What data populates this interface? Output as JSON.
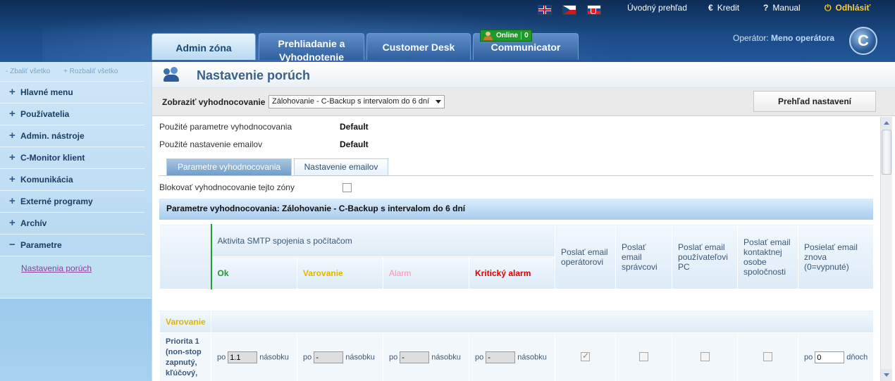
{
  "header": {
    "links": {
      "overview": "Úvodný prehľad",
      "credit": "Kredit",
      "manual": "Manual",
      "logout": "Odhlásiť"
    },
    "icons": {
      "credit": "euro-icon",
      "manual": "question-icon",
      "logout": "power-icon"
    },
    "tabs": {
      "admin": "Admin zóna",
      "review_line1": "Prehliadanie a",
      "review_line2": "Vyhodnotenie",
      "desk": "Customer Desk",
      "communicator": "Communicator"
    },
    "online": {
      "label": "Online",
      "count": "0"
    },
    "operator": {
      "label": "Operátor:",
      "name": "Meno operátora"
    },
    "logo_letter": "C"
  },
  "sidebar": {
    "collapse_all": "- Zbaliť všetko",
    "expand_all": "+ Rozbaliť všetko",
    "items": [
      {
        "sign": "+",
        "label": "Hlavné menu"
      },
      {
        "sign": "+",
        "label": "Používatelia"
      },
      {
        "sign": "+",
        "label": "Admin. nástroje"
      },
      {
        "sign": "+",
        "label": "C-Monitor klient"
      },
      {
        "sign": "+",
        "label": "Komunikácia"
      },
      {
        "sign": "+",
        "label": "Externé programy"
      },
      {
        "sign": "+",
        "label": "Archív"
      },
      {
        "sign": "−",
        "label": "Parametre"
      }
    ],
    "subitem": "Nastavenia porúch"
  },
  "main": {
    "title": "Nastavenie porúch",
    "filter_label": "Zobraziť vyhodnocovanie",
    "filter_value": "Zálohovanie - C-Backup s intervalom do 6 dní",
    "overview_button": "Prehľad nastavení",
    "info": {
      "params_label": "Použité parametre vyhodnocovania",
      "params_value": "Default",
      "email_label": "Použité nastavenie emailov",
      "email_value": "Default"
    },
    "subtabs": {
      "params": "Parametre vyhodnocovania",
      "email": "Nastavenie emailov"
    },
    "block_label": "Blokovať vyhodnocovanie tejto zóny",
    "section_title": "Parametre vyhodnocovania: Zálohovanie - C-Backup s intervalom do 6 dní",
    "table": {
      "smtp_header": "Aktivita SMTP spojenia s počítačom",
      "levels": {
        "ok": "Ok",
        "warn": "Varovanie",
        "alarm": "Alarm",
        "crit": "Kritický alarm"
      },
      "cols": {
        "send_operator": "Poslať email operátorovi",
        "send_admin": "Poslať email správcovi",
        "send_user": "Poslať email používateľovi PC",
        "send_contact": "Poslať email kontaktnej osobe spoločnosti",
        "resend": "Posielať email znova (0=vypnuté)"
      },
      "group_label": "Varovanie",
      "row": {
        "name": "Priorita 1 (non-stop zapnutý, kľúčový,",
        "prefix": "po",
        "suffix": "násobku",
        "ok_value": "1.1",
        "warn_value": "-",
        "alarm_value": "-",
        "crit_value": "-",
        "resend_prefix": "po",
        "resend_value": "0",
        "resend_suffix": "dňoch"
      }
    }
  }
}
